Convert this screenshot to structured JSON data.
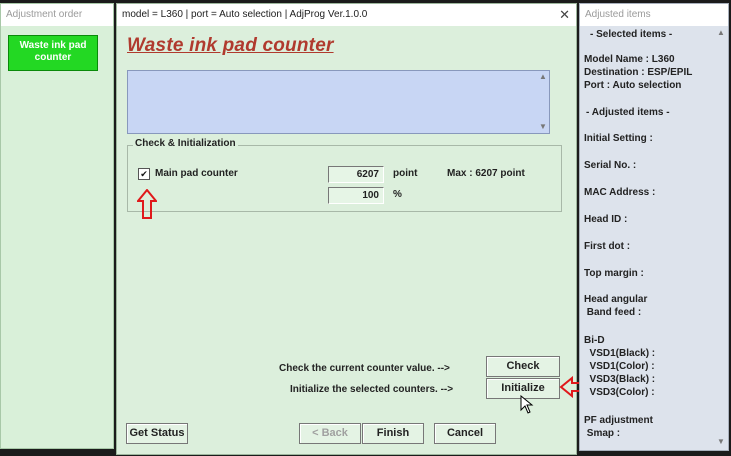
{
  "left_window": {
    "title": "Adjustment order",
    "selected_item": "Waste ink pad counter"
  },
  "main_window": {
    "title": "model = L360 | port = Auto selection | AdjProg Ver.1.0.0",
    "close_symbol": "✕",
    "heading": "Waste ink pad counter",
    "group_title": "Check & Initialization",
    "main_pad_label": "Main pad counter",
    "main_pad_checked": true,
    "counter_value": "6207",
    "counter_unit": "point",
    "max_label": "Max : 6207 point",
    "percent_value": "100",
    "percent_unit": "%",
    "check_text": "Check the current counter value. -->",
    "initialize_text": "Initialize the selected counters. -->",
    "check_button": "Check",
    "initialize_button": "Initialize",
    "get_status_button": "Get Status",
    "back_button": "< Back",
    "finish_button": "Finish",
    "cancel_button": "Cancel"
  },
  "right_window": {
    "title": "Adjusted items",
    "lines": [
      "- Selected items -",
      "Model Name : L360",
      "Destination : ESP/EPIL",
      "Port : Auto selection",
      "- Adjusted items -",
      "Initial Setting :",
      "Serial No. :",
      "MAC Address :",
      "Head ID :",
      "First dot :",
      "Top margin :",
      "Head angular",
      " Band feed :",
      "Bi-D",
      "  VSD1(Black) :",
      "  VSD1(Color) :",
      "  VSD3(Black) :",
      "  VSD3(Color) :",
      "PF adjustment",
      " Smap :"
    ]
  },
  "colors": {
    "heading": "#b03a2e",
    "annotation_arrow": "#e0191b",
    "selected_item_bg": "#23d823"
  }
}
